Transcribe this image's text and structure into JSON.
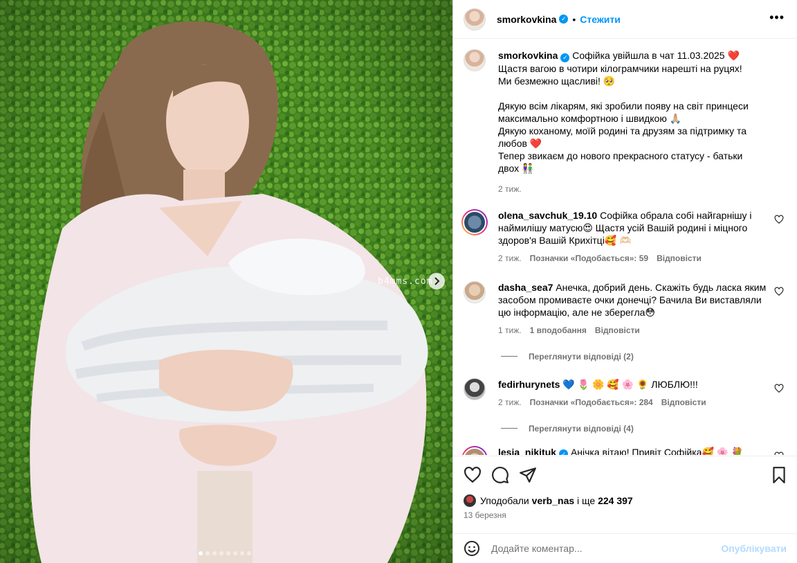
{
  "post": {
    "author": "smorkovkina",
    "follow_label": "Стежити",
    "separator": "•",
    "watermark": "b4mms.com"
  },
  "caption": {
    "author": "smorkovkina",
    "lines": [
      "Софійка увійшла в чат 11.03.2025 ❤️",
      "Щастя вагою в чотири кілограмчики нарешті на руцях!",
      "Ми безмежно щасливі! 🥺",
      "",
      "Дякую всім лікарям, які зробили появу на світ принцеси максимально комфортною і швидкою 🙏🏼",
      "Дякую коханому, моїй родині та друзям за підтримку та любов ❤️",
      "Тепер звикаєм до нового прекрасного статусу - батьки двох 👫"
    ],
    "time": "2 тиж."
  },
  "comments": [
    {
      "user": "olena_savchuk_19.10",
      "text": "Софійка обрала собі найгарнішу і наймилішу матусю😍 Щастя усій Вашій родині і міцного здоров'я Вашій Крихітці🥰 🫶🏻",
      "time": "2 тиж.",
      "likes": "Позначки «Подобається»: 59",
      "reply": "Відповісти"
    },
    {
      "user": "dasha_sea7",
      "text": "Анечка, добрий день. Скажіть будь ласка яким засобом промиваєте очки донечці? Бачила Ви виставляли цю інформацію, але не зберегла😳",
      "time": "1 тиж.",
      "likes": "1 вподобання",
      "reply": "Відповісти",
      "view_replies": "Переглянути відповіді (2)"
    },
    {
      "user": "fedirhurynets",
      "text": "💙 🌷 🌼 🥰 🌸 🌻 ЛЮБЛЮ!!!",
      "time": "2 тиж.",
      "likes": "Позначки «Подобається»: 284",
      "reply": "Відповісти",
      "view_replies": "Переглянути відповіді (4)"
    },
    {
      "user": "lesia_nikituk",
      "text": "Анічка вітаю! Привіт Софійка🥰 🌸 💐"
    }
  ],
  "likes_summary": {
    "prefix": "Уподобали",
    "user": "verb_nas",
    "middle": "і ще",
    "count": "224 397"
  },
  "post_date": "13 березня",
  "add_comment": {
    "placeholder": "Додайте коментар...",
    "publish": "Опублікувати"
  },
  "colors": {
    "accent": "#0095f6",
    "muted": "#737373",
    "publish_disabled": "#b3dbff"
  },
  "carousel": {
    "slides": 8,
    "active": 1
  }
}
